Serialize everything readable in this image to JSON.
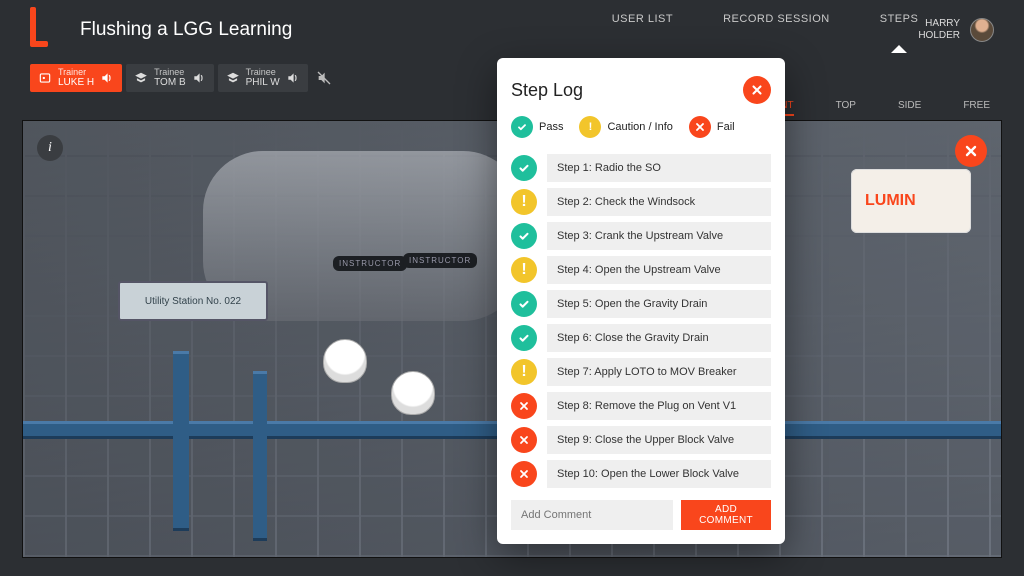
{
  "header": {
    "title": "Flushing a LGG Learning",
    "nav": [
      {
        "label": "USER LIST",
        "active": false
      },
      {
        "label": "RECORD SESSION",
        "active": false
      },
      {
        "label": "STEPS",
        "active": true
      }
    ],
    "user": {
      "line1": "HARRY",
      "line2": "HOLDER"
    }
  },
  "participants": [
    {
      "role": "Trainer",
      "name": "LUKE H",
      "active": true,
      "muted": false
    },
    {
      "role": "Trainee",
      "name": "TOM B",
      "active": false,
      "muted": false
    },
    {
      "role": "Trainee",
      "name": "PHIL W",
      "active": false,
      "muted": true
    }
  ],
  "camera_tabs": [
    {
      "label": "FRONT",
      "active": true
    },
    {
      "label": "TOP",
      "active": false
    },
    {
      "label": "SIDE",
      "active": false
    },
    {
      "label": "FREE",
      "active": false
    }
  ],
  "scene": {
    "station_sign": "Utility Station No. 022",
    "banner": "LUMIN",
    "tag_instructor_1": "INSTRUCTOR",
    "tag_instructor_2": "INSTRUCTOR"
  },
  "colors": {
    "accent": "#f9461c",
    "pass": "#1fbf9c",
    "caution": "#f2c52b",
    "fail": "#f9461c"
  },
  "step_log": {
    "title": "Step Log",
    "legend": {
      "pass": "Pass",
      "caution": "Caution / Info",
      "fail": "Fail"
    },
    "steps": [
      {
        "status": "pass",
        "label": "Step 1: Radio the SO"
      },
      {
        "status": "caution",
        "label": "Step 2: Check the Windsock"
      },
      {
        "status": "pass",
        "label": "Step 3: Crank the Upstream Valve"
      },
      {
        "status": "caution",
        "label": "Step 4: Open the Upstream Valve"
      },
      {
        "status": "pass",
        "label": "Step 5: Open the Gravity Drain"
      },
      {
        "status": "pass",
        "label": "Step 6: Close the Gravity Drain"
      },
      {
        "status": "caution",
        "label": "Step 7: Apply LOTO to MOV Breaker"
      },
      {
        "status": "fail",
        "label": "Step 8: Remove the Plug on Vent V1"
      },
      {
        "status": "fail",
        "label": "Step 9: Close the Upper Block Valve"
      },
      {
        "status": "fail",
        "label": "Step 10: Open the Lower Block Valve"
      }
    ],
    "comment_placeholder": "Add Comment",
    "comment_button": "ADD COMMENT"
  }
}
